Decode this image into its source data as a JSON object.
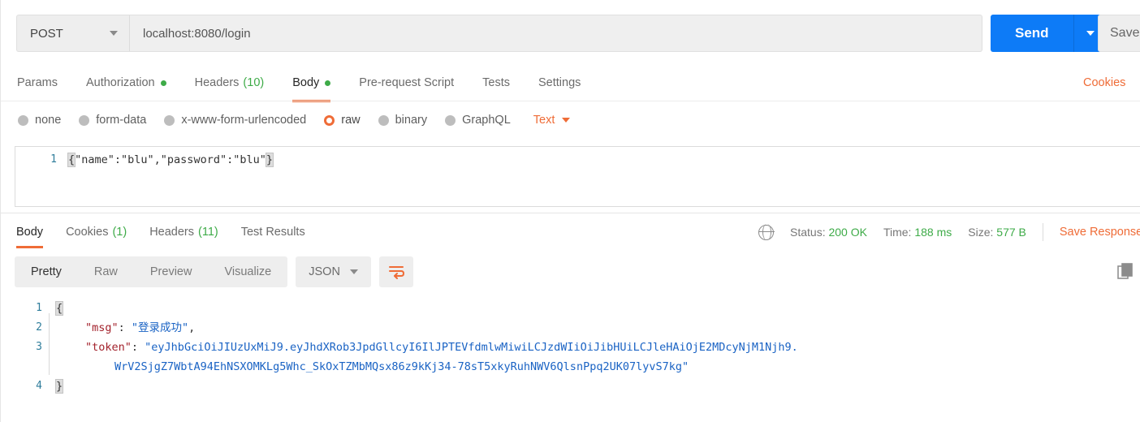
{
  "request": {
    "method": "POST",
    "url": "localhost:8080/login",
    "send_label": "Send",
    "save_label": "Save",
    "cookies_link": "Cookies",
    "tabs": [
      {
        "label": "Params",
        "badge": "",
        "dot": false,
        "active": false
      },
      {
        "label": "Authorization",
        "badge": "",
        "dot": true,
        "active": false
      },
      {
        "label": "Headers",
        "badge": "(10)",
        "dot": false,
        "active": false
      },
      {
        "label": "Body",
        "badge": "",
        "dot": true,
        "active": true
      },
      {
        "label": "Pre-request Script",
        "badge": "",
        "dot": false,
        "active": false
      },
      {
        "label": "Tests",
        "badge": "",
        "dot": false,
        "active": false
      },
      {
        "label": "Settings",
        "badge": "",
        "dot": false,
        "active": false
      }
    ],
    "body_types": [
      {
        "label": "none",
        "selected": false
      },
      {
        "label": "form-data",
        "selected": false
      },
      {
        "label": "x-www-form-urlencoded",
        "selected": false
      },
      {
        "label": "raw",
        "selected": true
      },
      {
        "label": "binary",
        "selected": false
      },
      {
        "label": "GraphQL",
        "selected": false
      }
    ],
    "raw_format": "Text",
    "body_line_number": "1",
    "body_open_brace": "{",
    "body_content": "\"name\":\"blu\",\"password\":\"blu\"",
    "body_close_brace": "}"
  },
  "response": {
    "tabs": [
      {
        "label": "Body",
        "badge": "",
        "active": true
      },
      {
        "label": "Cookies",
        "badge": "(1)",
        "active": false
      },
      {
        "label": "Headers",
        "badge": "(11)",
        "active": false
      },
      {
        "label": "Test Results",
        "badge": "",
        "active": false
      }
    ],
    "status_label": "Status:",
    "status_value": "200 OK",
    "time_label": "Time:",
    "time_value": "188 ms",
    "size_label": "Size:",
    "size_value": "577 B",
    "save_response": "Save Response",
    "view_modes": [
      {
        "label": "Pretty",
        "active": true
      },
      {
        "label": "Raw",
        "active": false
      },
      {
        "label": "Preview",
        "active": false
      },
      {
        "label": "Visualize",
        "active": false
      }
    ],
    "format": "JSON",
    "line_numbers": [
      "1",
      "2",
      "3",
      "4"
    ],
    "open_brace": "{",
    "close_brace": "}",
    "msg_key": "\"msg\"",
    "msg_colon": ": ",
    "msg_value": "\"登录成功\"",
    "msg_comma": ",",
    "token_key": "\"token\"",
    "token_colon": ": ",
    "token_value_line1": "\"eyJhbGciOiJIUzUxMiJ9.eyJhdXRob3JpdGllcyI6IlJPTEVfdmlwMiwiLCJzdWIiOiJibHUiLCJleHAiOjE2MDcyNjM1Njh9.",
    "token_value_line2": "WrV2SjgZ7WbtA94EhNSXOMKLg5Whc_SkOxTZMbMQsx86z9kKj34-78sT5xkyRuhNWV6QlsnPpq2UK07lyvS7kg\""
  },
  "colors": {
    "accent_orange": "#ef6c37",
    "send_blue": "#0d7bf7",
    "status_green": "#3eab48",
    "json_key": "#a3222c",
    "json_string": "#1a63c4",
    "gutter": "#2f7d9b"
  }
}
